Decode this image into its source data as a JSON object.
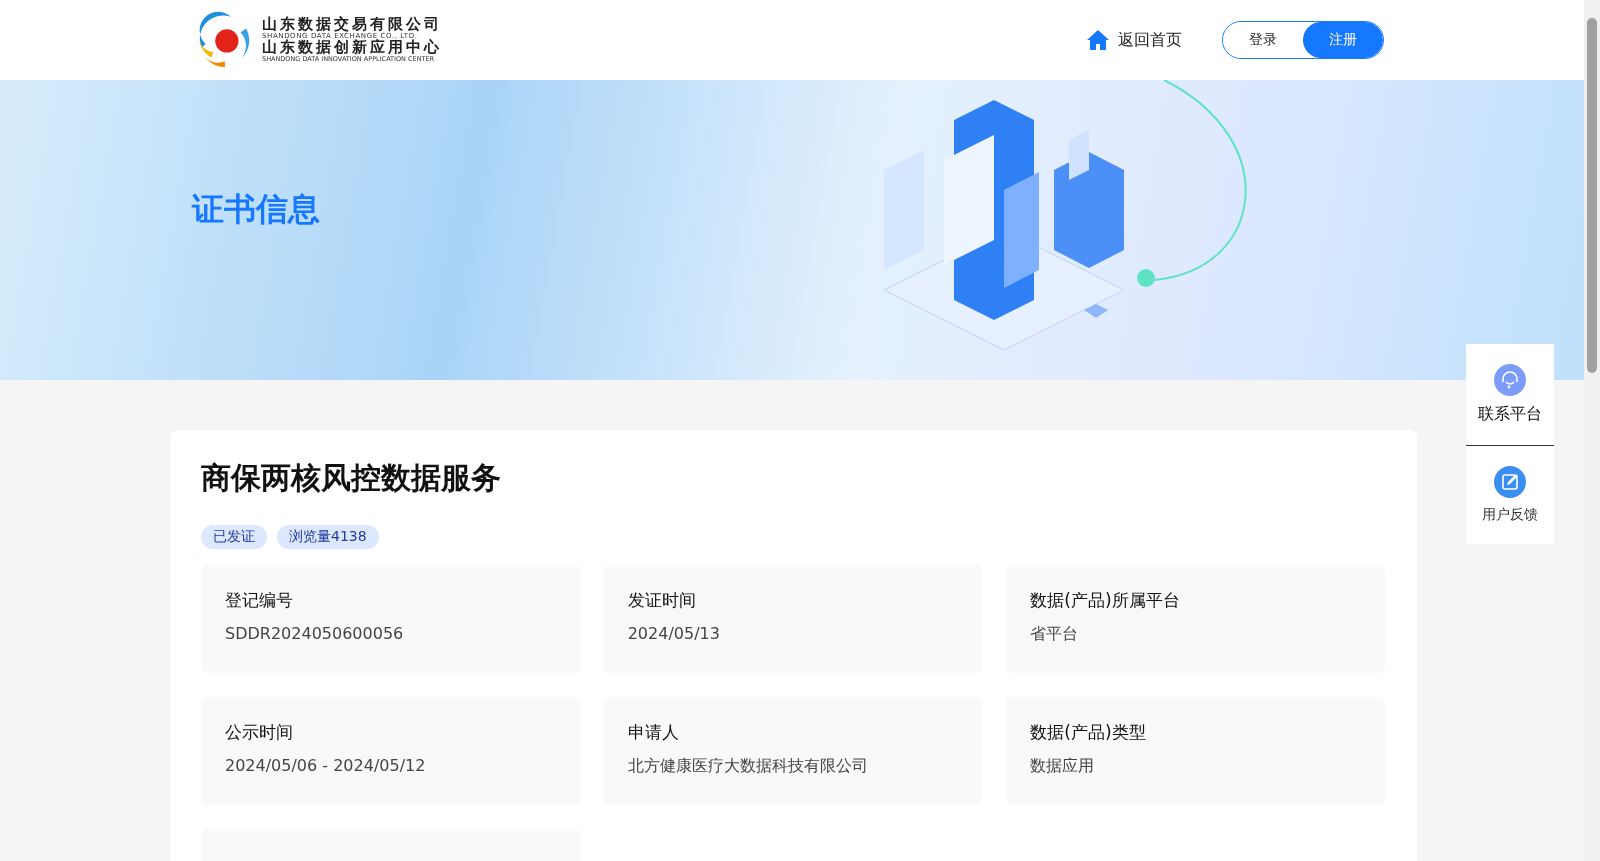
{
  "header": {
    "logo": {
      "name_cn": "山东数据交易有限公司",
      "name_en": "SHANDONG DATA EXCHANGE CO., LTD.",
      "center_cn": "山东数据创新应用中心",
      "center_en": "SHANDONG DATA INNOVATION APPLICATION CENTER"
    },
    "home_link": "返回首页",
    "auth_buttons": [
      {
        "label": "登录",
        "selected": false
      },
      {
        "label": "注册",
        "selected": true
      }
    ]
  },
  "banner": {
    "title": "证书信息"
  },
  "certificate": {
    "title": "商保两核风控数据服务",
    "tags": [
      "已发证",
      "浏览量4138"
    ],
    "fields": [
      {
        "kind": "text",
        "label": "登记编号",
        "value": "SDDR2024050600056"
      },
      {
        "kind": "text",
        "label": "发证时间",
        "value": "2024/05/13"
      },
      {
        "kind": "text",
        "label": "数据(产品)所属平台",
        "value": "省平台"
      },
      {
        "kind": "text",
        "label": "公示时间",
        "value": "2024/05/06 - 2024/05/12"
      },
      {
        "kind": "text",
        "label": "申请人",
        "value": "北方健康医疗大数据科技有限公司"
      },
      {
        "kind": "text",
        "label": "数据(产品)类型",
        "value": "数据应用"
      },
      {
        "kind": "cut"
      }
    ]
  },
  "side_panel": [
    {
      "kind": "headset",
      "label": "联系平台"
    },
    {
      "kind": "edit",
      "label": "用户反馈"
    }
  ]
}
